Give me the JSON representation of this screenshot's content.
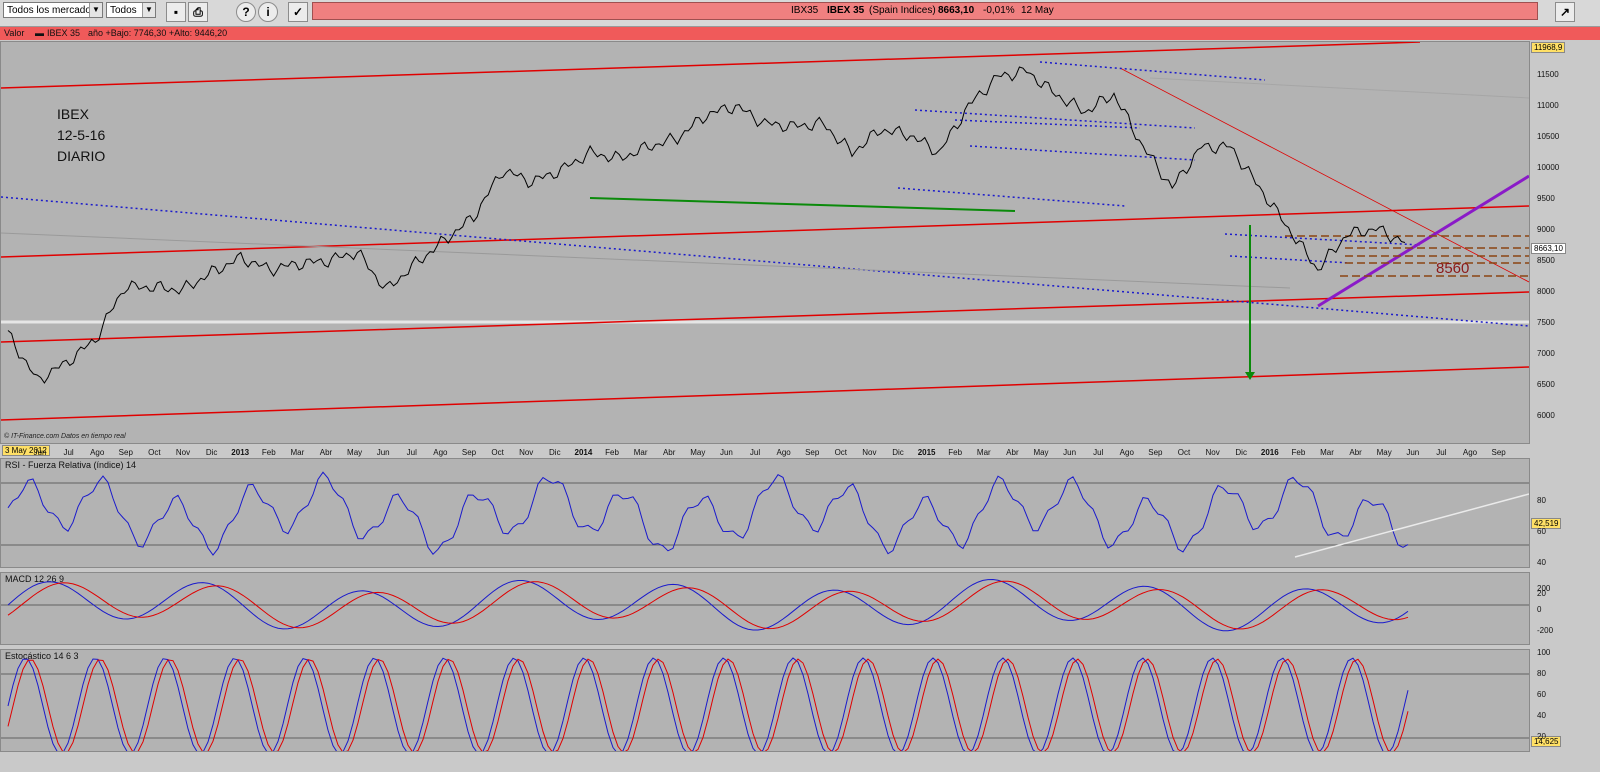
{
  "toolbar": {
    "market_select": "Todos los mercados",
    "filter_select": "Todos",
    "save_icon": "save-icon",
    "print_icon": "print-icon",
    "help_icon": "help-icon",
    "info_icon": "info-icon",
    "chart_icon": "chart-icon"
  },
  "quote": {
    "ticker": "IBX35",
    "name": "IBEX 35",
    "market": "(Spain Indices)",
    "price": "8663,10",
    "change": "-0,01%",
    "date": "12 May"
  },
  "value_bar": {
    "valor": "Valor",
    "series": "IBEX 35",
    "range": "año +Bajo: 7746,30 +Alto: 9446,20"
  },
  "chart": {
    "annotation_lines": [
      "IBEX",
      "12-5-16",
      "DIARIO"
    ],
    "level_label": "8560",
    "start_date": "3 May 2012",
    "source": "© IT-Finance.com  Datos en tiempo real",
    "current_price_tag": "8663,10",
    "max_tag": "11968,9",
    "y_ticks": [
      "11500",
      "11000",
      "10500",
      "10000",
      "9500",
      "9000",
      "8500",
      "8000",
      "7500",
      "7000",
      "6500",
      "6000"
    ],
    "x_ticks": [
      "Jun",
      "Jul",
      "Ago",
      "Sep",
      "Oct",
      "Nov",
      "Dic",
      "2013",
      "Feb",
      "Mar",
      "Abr",
      "May",
      "Jun",
      "Jul",
      "Ago",
      "Sep",
      "Oct",
      "Nov",
      "Dic",
      "2014",
      "Feb",
      "Mar",
      "Abr",
      "May",
      "Jun",
      "Jul",
      "Ago",
      "Sep",
      "Oct",
      "Nov",
      "Dic",
      "2015",
      "Feb",
      "Mar",
      "Abr",
      "May",
      "Jun",
      "Jul",
      "Ago",
      "Sep",
      "Oct",
      "Nov",
      "Dic",
      "2016",
      "Feb",
      "Mar",
      "Abr",
      "May",
      "Jun",
      "Jul",
      "Ago",
      "Sep"
    ],
    "colors": {
      "trend_red": "#e00000",
      "channel_blue": "#1a1acc",
      "support_green": "#0a8a0a",
      "purple": "#8a1ac8",
      "brown_dash": "#8b4513"
    }
  },
  "rsi": {
    "title": "RSI - Fuerza Relativa (índice) 14",
    "value_tag": "42,519",
    "y_ticks": [
      "80",
      "60",
      "40",
      "20"
    ]
  },
  "macd": {
    "title": "MACD 12 26 9",
    "y_ticks": [
      "200",
      "0",
      "-200"
    ]
  },
  "stoch": {
    "title": "Estocástico 14 6 3",
    "value_tag": "14,625",
    "y_ticks": [
      "100",
      "80",
      "60",
      "40",
      "20"
    ]
  },
  "chart_data": {
    "type": "line",
    "title": "IBEX 35",
    "x": [
      "2012-05",
      "2012-06",
      "2012-07",
      "2012-08",
      "2012-09",
      "2012-10",
      "2012-11",
      "2012-12",
      "2013-01",
      "2013-02",
      "2013-03",
      "2013-04",
      "2013-05",
      "2013-06",
      "2013-07",
      "2013-08",
      "2013-09",
      "2013-10",
      "2013-11",
      "2013-12",
      "2014-01",
      "2014-02",
      "2014-03",
      "2014-04",
      "2014-05",
      "2014-06",
      "2014-07",
      "2014-08",
      "2014-09",
      "2014-10",
      "2014-11",
      "2014-12",
      "2015-01",
      "2015-02",
      "2015-03",
      "2015-04",
      "2015-05",
      "2015-06",
      "2015-07",
      "2015-08",
      "2015-09",
      "2015-10",
      "2015-11",
      "2015-12",
      "2016-01",
      "2016-02",
      "2016-03",
      "2016-04",
      "2016-05"
    ],
    "series": [
      {
        "name": "IBEX 35",
        "values": [
          7100,
          6300,
          6600,
          7000,
          7900,
          7900,
          7850,
          8150,
          8400,
          8200,
          8300,
          8350,
          8500,
          7850,
          8300,
          8700,
          9100,
          9900,
          9700,
          9900,
          10200,
          10100,
          10300,
          10450,
          10850,
          11000,
          10700,
          10650,
          10700,
          10200,
          10600,
          10500,
          10200,
          11000,
          11500,
          11600,
          11200,
          10900,
          11200,
          10300,
          9600,
          10300,
          10300,
          9600,
          8900,
          8200,
          8800,
          8900,
          8663
        ]
      }
    ],
    "ylim": [
      5800,
      12000
    ],
    "grid": false
  }
}
